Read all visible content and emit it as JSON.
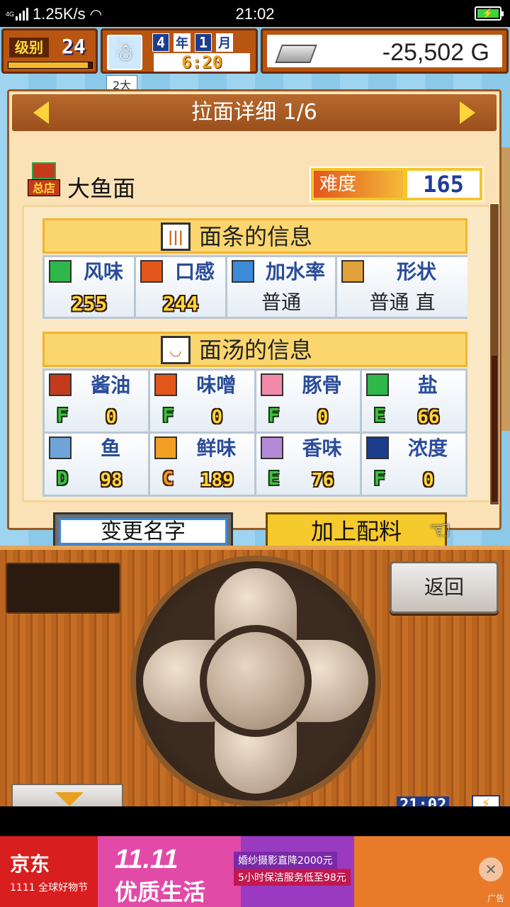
{
  "status_bar": {
    "network": "4G",
    "speed": "1.25K/s",
    "time": "21:02",
    "battery_charging": "⚡"
  },
  "hud": {
    "level_label": "级别",
    "level": "24",
    "level_progress": 0.95,
    "year": "4",
    "year_unit": "年",
    "month": "1",
    "month_unit": "月",
    "clock": "6:20",
    "money": "-25,502 G"
  },
  "bg": {
    "tab_text": "2大"
  },
  "panel": {
    "title": "拉面详细 1/6",
    "shop_badge": "总店",
    "ramen_name": "大鱼面",
    "difficulty_label": "难度",
    "difficulty_value": "165"
  },
  "noodle": {
    "title": "面条的信息",
    "items": [
      {
        "label": "风味",
        "value": "255",
        "icon": "flavor-icon",
        "icon_color": "#2eb84a"
      },
      {
        "label": "口感",
        "value": "244",
        "icon": "texture-icon",
        "icon_color": "#e2561c"
      },
      {
        "label": "加水率",
        "value": "普通",
        "icon": "water-drop-icon",
        "icon_color": "#3c8ad8"
      },
      {
        "label": "形状",
        "value": "普通 直",
        "icon": "shape-icon",
        "icon_color": "#e2a03a"
      }
    ]
  },
  "soup": {
    "title": "面汤的信息",
    "items": [
      {
        "label": "酱油",
        "grade": "F",
        "value": "0",
        "icon": "soy-sauce-icon",
        "icon_color": "#c43a1c"
      },
      {
        "label": "味噌",
        "grade": "F",
        "value": "0",
        "icon": "miso-icon",
        "icon_color": "#e2561c"
      },
      {
        "label": "豚骨",
        "grade": "F",
        "value": "0",
        "icon": "pork-bone-icon",
        "icon_color": "#f08aa8"
      },
      {
        "label": "盐",
        "grade": "E",
        "value": "66",
        "icon": "salt-icon",
        "icon_color": "#2eb84a"
      },
      {
        "label": "鱼",
        "grade": "D",
        "value": "98",
        "icon": "fish-icon",
        "icon_color": "#6fa4d8"
      },
      {
        "label": "鲜味",
        "grade": "C",
        "value": "189",
        "icon": "umami-icon",
        "icon_color": "#f2a025"
      },
      {
        "label": "香味",
        "grade": "E",
        "value": "76",
        "icon": "aroma-icon",
        "icon_color": "#b48ad8"
      },
      {
        "label": "浓度",
        "grade": "F",
        "value": "0",
        "icon": "density-icon",
        "icon_color": "#1d3c8c"
      }
    ]
  },
  "buttons": {
    "rename": "变更名字",
    "add_topping": "加上配料",
    "back": "返回"
  },
  "controller": {
    "clock": "21:02",
    "battery": "⚡"
  },
  "ad": {
    "brand": "京东",
    "sub": "1111 全球好物节",
    "big": "11.11",
    "slogan": "优质生活",
    "line1": "婚纱摄影直降2000元",
    "line2": "5小时保洁服务低至98元",
    "label": "广告",
    "close": "✕"
  }
}
